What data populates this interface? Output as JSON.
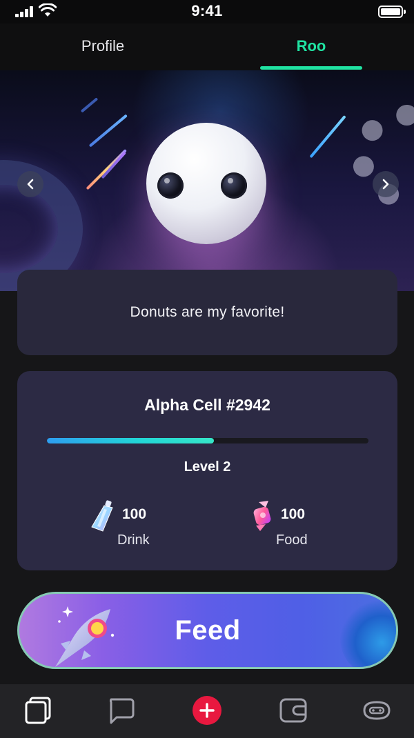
{
  "status_bar": {
    "time": "9:41",
    "icons": [
      "signal-icon",
      "wifi-icon",
      "battery-icon"
    ]
  },
  "tabs": [
    {
      "label": "Profile",
      "active": false
    },
    {
      "label": "Roo",
      "active": true
    }
  ],
  "colors": {
    "accent": "#20e3a2",
    "card": "#2c2a44",
    "background": "#161618",
    "add_button": "#e8183f"
  },
  "hero": {
    "icons": [
      "chevron-left-icon",
      "chevron-right-icon"
    ]
  },
  "message": {
    "text": "Donuts are my favorite!"
  },
  "pet": {
    "name": "Alpha Cell #2942",
    "level_label": "Level 2",
    "level_progress": 0.52,
    "stats": [
      {
        "value": "100",
        "label": "Drink",
        "icon": "drink-pouch-icon"
      },
      {
        "value": "100",
        "label": "Food",
        "icon": "candy-icon"
      }
    ]
  },
  "feed_button": {
    "label": "Feed"
  },
  "bottom_nav": {
    "items": [
      {
        "icon": "cards-icon",
        "active": true
      },
      {
        "icon": "chat-icon",
        "active": false
      },
      {
        "icon": "add-icon",
        "active": false
      },
      {
        "icon": "wallet-icon",
        "active": false
      },
      {
        "icon": "pet-icon",
        "active": false
      }
    ]
  }
}
